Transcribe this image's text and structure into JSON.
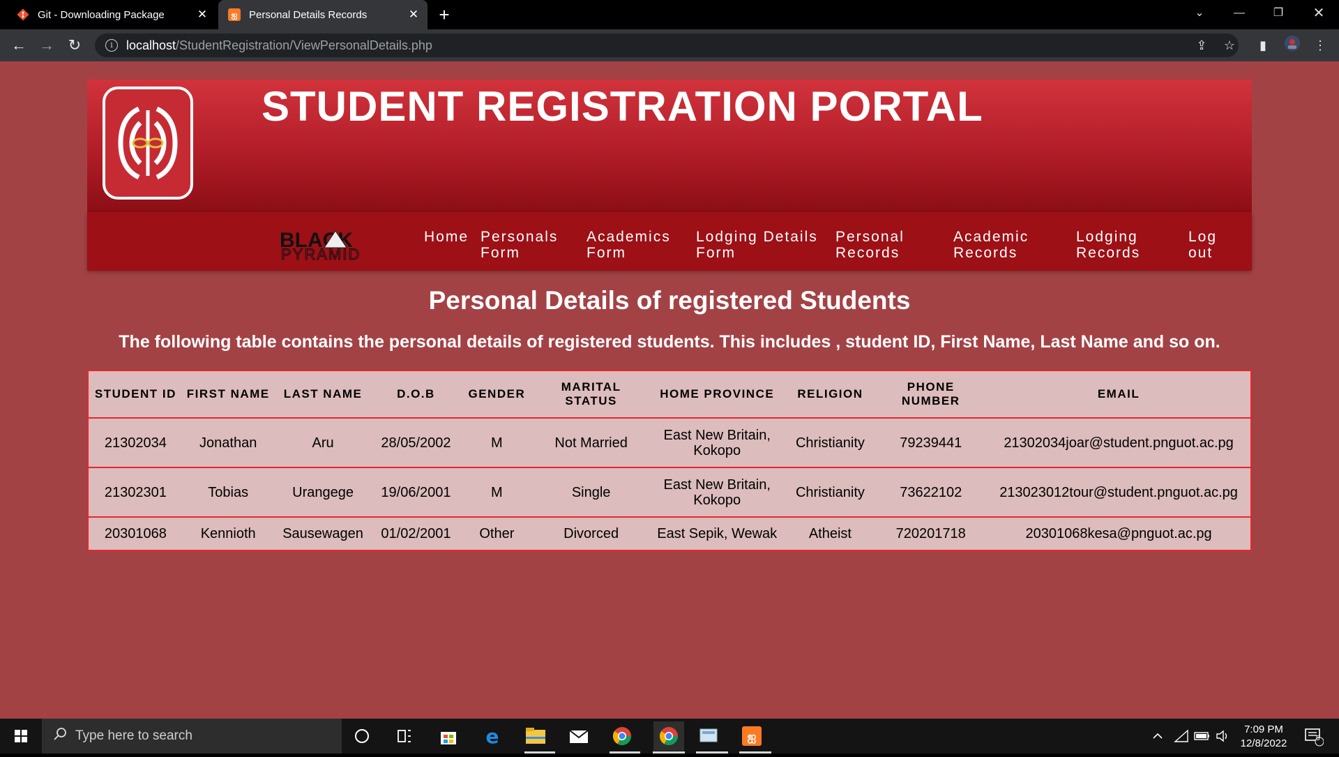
{
  "browser": {
    "tabs": [
      {
        "label": "Git - Downloading Package",
        "active": false
      },
      {
        "label": "Personal Details Records",
        "active": true
      }
    ],
    "url_host": "localhost",
    "url_path": "/StudentRegistration/ViewPersonalDetails.php"
  },
  "header": {
    "title": "STUDENT REGISTRATION PORTAL",
    "partner_logo_top": "BLACK",
    "partner_logo_bottom": "PYRAMID"
  },
  "nav": {
    "items": [
      {
        "label": "Home"
      },
      {
        "label": "Personals Form"
      },
      {
        "label": "Academics Form"
      },
      {
        "label": "Lodging Details Form"
      },
      {
        "label": "Personal Records"
      },
      {
        "label": "Academic Records"
      },
      {
        "label": "Lodging Records"
      },
      {
        "label": "Log out"
      }
    ]
  },
  "main": {
    "heading": "Personal Details of registered Students",
    "description": "The following table contains the personal details of registered students. This includes , student ID, First Name, Last Name and so on."
  },
  "table": {
    "headers": [
      "STUDENT ID",
      "FIRST NAME",
      "LAST NAME",
      "D.O.B",
      "GENDER",
      "MARITAL STATUS",
      "HOME PROVINCE",
      "RELIGION",
      "PHONE NUMBER",
      "EMAIL"
    ],
    "rows": [
      [
        "21302034",
        "Jonathan",
        "Aru",
        "28/05/2002",
        "M",
        "Not Married",
        "East New Britain, Kokopo",
        "Christianity",
        "79239441",
        "21302034joar@student.pnguot.ac.pg"
      ],
      [
        "21302301",
        "Tobias",
        "Urangege",
        "19/06/2001",
        "M",
        "Single",
        "East New Britain, Kokopo",
        "Christianity",
        "73622102",
        "213023012tour@student.pnguot.ac.pg"
      ],
      [
        "20301068",
        "Kennioth",
        "Sausewagen",
        "01/02/2001",
        "Other",
        "Divorced",
        "East Sepik, Wewak",
        "Atheist",
        "720201718",
        "20301068kesa@pnguot.ac.pg"
      ]
    ]
  },
  "taskbar": {
    "search_placeholder": "Type here to search",
    "time": "7:09 PM",
    "date": "12/8/2022",
    "notification_count": "5"
  },
  "colors": {
    "page_background": "#a34245",
    "banner_top": "#d2333c",
    "nav_background": "#9c1016",
    "table_background": "#dcbcbc",
    "table_border": "#e2282e"
  }
}
